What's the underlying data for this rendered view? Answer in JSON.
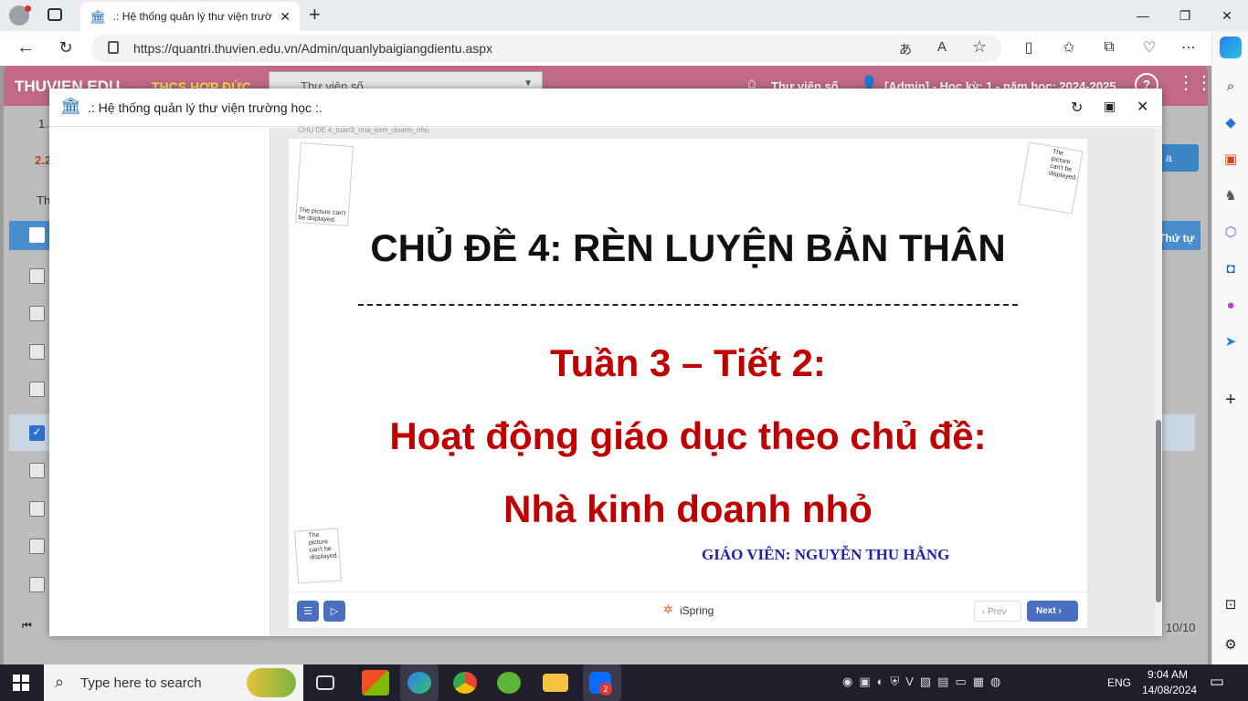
{
  "browser": {
    "tab_title": ".: Hệ thống quản lý thư viện trườ",
    "new_tab": "+",
    "url": "https://quantri.thuvien.edu.vn/Admin/quanlybaigiangdientu.aspx"
  },
  "app": {
    "logo": "THUVIEN.EDU",
    "school": "THCS HỢP ĐỨC",
    "library_select": "Thư viện số",
    "nav_library": "Thư viện số",
    "user_info": "[Admin] - Học kỳ: 1 - năm học: 2024-2025",
    "row1_label": "1.",
    "row2_label": "2.2",
    "toolbar_text": "Th",
    "button_right": "a",
    "col_order": "Thứ tự",
    "pager_count": "10/10"
  },
  "modal": {
    "title": ".: Hệ thống quản lý thư viện trường học :.",
    "file_caption": "CHU DE 4_tuan3_nha_kinh_doanh_nho"
  },
  "slide": {
    "heading": "CHỦ ĐỀ 4: RÈN LUYỆN BẢN THÂN",
    "week": "Tuần 3 – Tiết 2:",
    "activity": "Hoạt động giáo dục theo chủ đề:",
    "topic": "Nhà kinh doanh nhỏ",
    "teacher": "GIÁO VIÊN: NGUYỄN THU HẰNG",
    "placeholder_text": "The picture can't be displayed."
  },
  "player": {
    "brand": "iSpring",
    "prev": "Prev",
    "next": "Next"
  },
  "taskbar": {
    "search_placeholder": "Type here to search",
    "language": "ENG",
    "time": "9:04 AM",
    "date": "14/08/2024",
    "zalo_badge": "2"
  },
  "colors": {
    "app_header": "#c06a86",
    "slide_red": "#c00000",
    "teacher_blue": "#1f1fb3",
    "player_blue": "#4a6fc0"
  }
}
